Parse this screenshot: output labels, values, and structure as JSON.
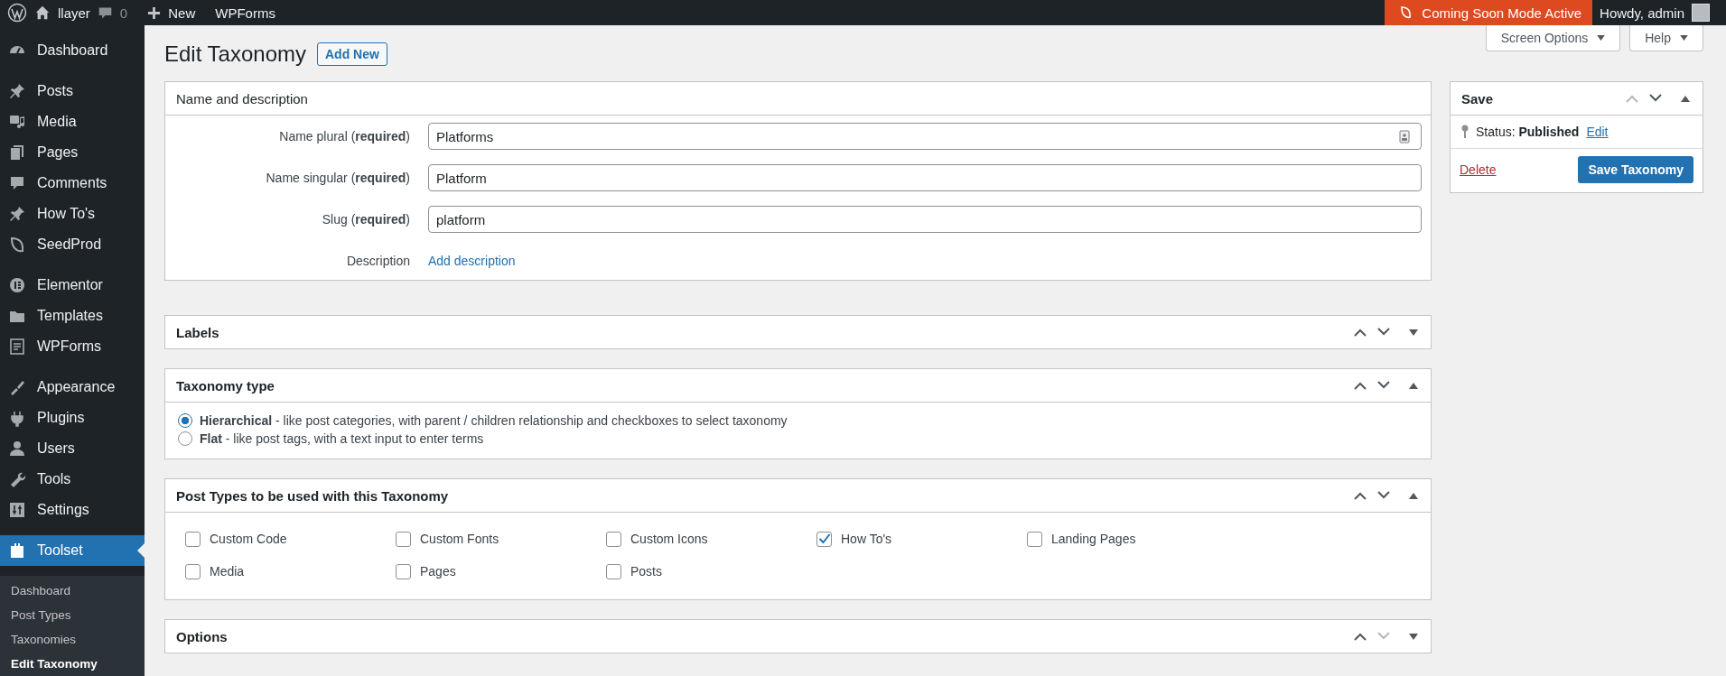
{
  "admin_bar": {
    "site_name": "llayer",
    "comments_count": "0",
    "new_label": "New",
    "wpforms_label": "WPForms",
    "coming_soon": "Coming Soon Mode Active",
    "greeting": "Howdy, admin"
  },
  "sidebar": {
    "groups": [
      {
        "items": [
          {
            "label": "Dashboard",
            "selected": false
          }
        ]
      },
      {
        "items": [
          {
            "label": "Posts",
            "selected": false
          },
          {
            "label": "Media",
            "selected": false
          },
          {
            "label": "Pages",
            "selected": false
          },
          {
            "label": "Comments",
            "selected": false
          },
          {
            "label": "How To's",
            "selected": false
          },
          {
            "label": "SeedProd",
            "selected": false
          }
        ]
      },
      {
        "items": [
          {
            "label": "Elementor",
            "selected": false
          },
          {
            "label": "Templates",
            "selected": false
          },
          {
            "label": "WPForms",
            "selected": false
          }
        ]
      },
      {
        "items": [
          {
            "label": "Appearance",
            "selected": false
          },
          {
            "label": "Plugins",
            "selected": false
          },
          {
            "label": "Users",
            "selected": false
          },
          {
            "label": "Tools",
            "selected": false
          },
          {
            "label": "Settings",
            "selected": false
          }
        ]
      },
      {
        "items": [
          {
            "label": "Toolset",
            "selected": true
          }
        ]
      }
    ],
    "submenu": [
      {
        "label": "Dashboard",
        "selected": false
      },
      {
        "label": "Post Types",
        "selected": false
      },
      {
        "label": "Taxonomies",
        "selected": false
      },
      {
        "label": "Edit Taxonomy",
        "selected": true
      }
    ]
  },
  "screen_options": "Screen Options",
  "help": "Help",
  "page_title": "Edit Taxonomy",
  "add_new": "Add New",
  "panels": [
    {
      "kind": "fields",
      "title": "Name and description",
      "fields": [
        {
          "label": "Name plural (**required**)",
          "value": "Platforms"
        },
        {
          "label": "Name singular (**required**)",
          "value": "Platform"
        },
        {
          "label": "Slug (**required**)",
          "value": "platform"
        }
      ],
      "description_label": "Description",
      "description_link": "Add description"
    },
    {
      "kind": "empty",
      "title": "Labels",
      "expanded": false,
      "can_move_up": true,
      "can_move_down": true
    },
    {
      "kind": "radios",
      "title": "Taxonomy type",
      "expanded": true,
      "can_move_up": true,
      "can_move_down": true,
      "options": [
        {
          "label": "**Hierarchical** - like post categories, with parent / children relationship and checkboxes to select taxonomy",
          "selected": true
        },
        {
          "label": "**Flat** - like post tags, with a text input to enter terms",
          "selected": false
        }
      ]
    },
    {
      "kind": "checks",
      "title": "Post Types to be used with this Taxonomy",
      "expanded": true,
      "can_move_up": true,
      "can_move_down": true,
      "options": [
        {
          "label": "Custom Code",
          "checked": false
        },
        {
          "label": "Custom Fonts",
          "checked": false
        },
        {
          "label": "Custom Icons",
          "checked": false
        },
        {
          "label": "How To's",
          "checked": true
        },
        {
          "label": "Landing Pages",
          "checked": false
        },
        {
          "label": "Media",
          "checked": false
        },
        {
          "label": "Pages",
          "checked": false
        },
        {
          "label": "Posts",
          "checked": false
        }
      ]
    },
    {
      "kind": "empty",
      "title": "Options",
      "expanded": false,
      "can_move_up": true,
      "can_move_down": false
    }
  ],
  "save_box": {
    "title": "Save",
    "expanded": true,
    "can_move_up": false,
    "can_move_down": true,
    "status": "Status: **Published**",
    "status_link": "Edit",
    "delete": "Delete",
    "save_button": "Save Taxonomy"
  }
}
